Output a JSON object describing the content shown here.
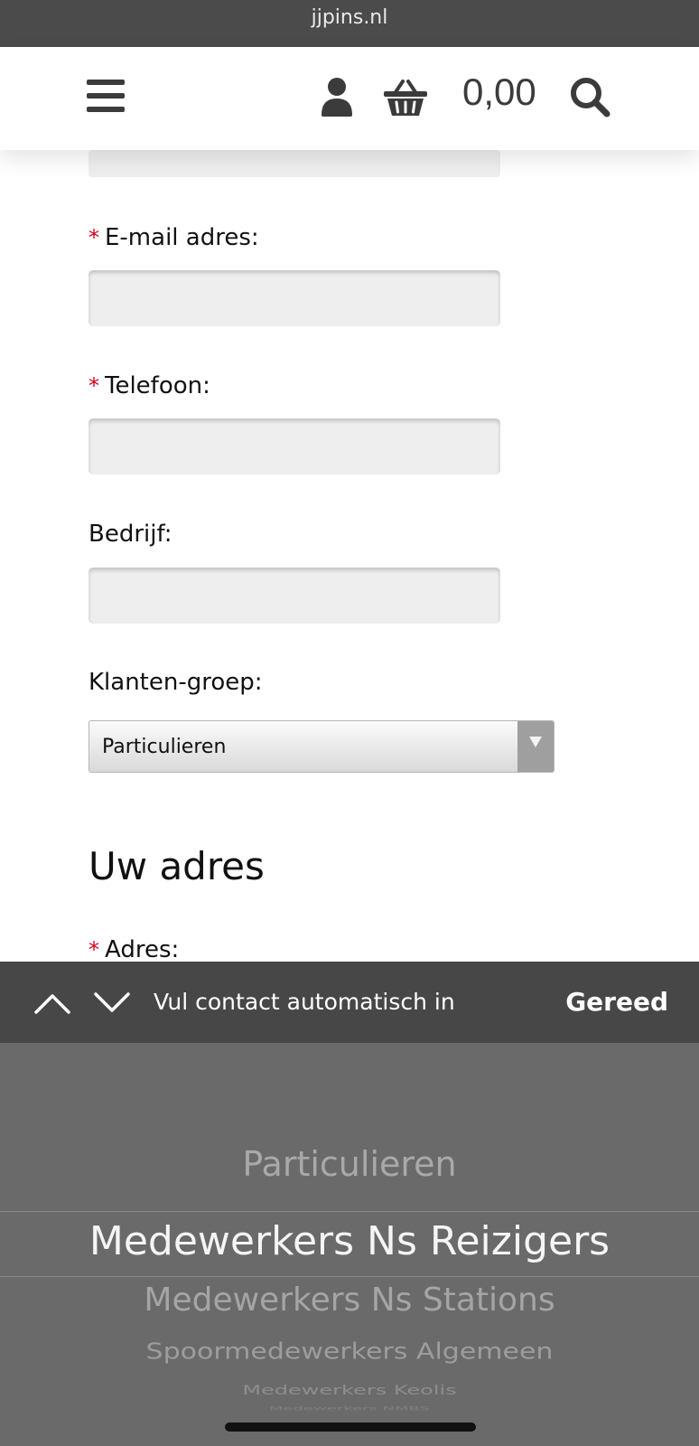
{
  "browser": {
    "domain": "jjpins.nl"
  },
  "header": {
    "menu_icon": "hamburger-menu-icon",
    "account_icon": "user-icon",
    "cart_icon": "basket-icon",
    "cart_total": "0,00",
    "search_icon": "magnifier-icon"
  },
  "form": {
    "email_label": "E-mail adres:",
    "phone_label": "Telefoon:",
    "company_label": "Bedrijf:",
    "customer_group_label": "Klanten-groep:",
    "customer_group_value": "Particulieren",
    "required_marker": "*",
    "address_section_title": "Uw adres",
    "address_label": "Adres:"
  },
  "keyboard_accessory": {
    "prev_icon": "chevron-up-icon",
    "next_icon": "chevron-down-icon",
    "autofill_label": "Vul contact automatisch in",
    "done_label": "Gereed"
  },
  "picker": {
    "options": [
      "Particulieren",
      "Medewerkers Ns Reizigers",
      "Medewerkers Ns Stations",
      "Spoormedewerkers Algemeen",
      "Medewerkers Keolis",
      "Medewerkers NMBS"
    ],
    "selected": "Medewerkers Ns Reizigers"
  }
}
